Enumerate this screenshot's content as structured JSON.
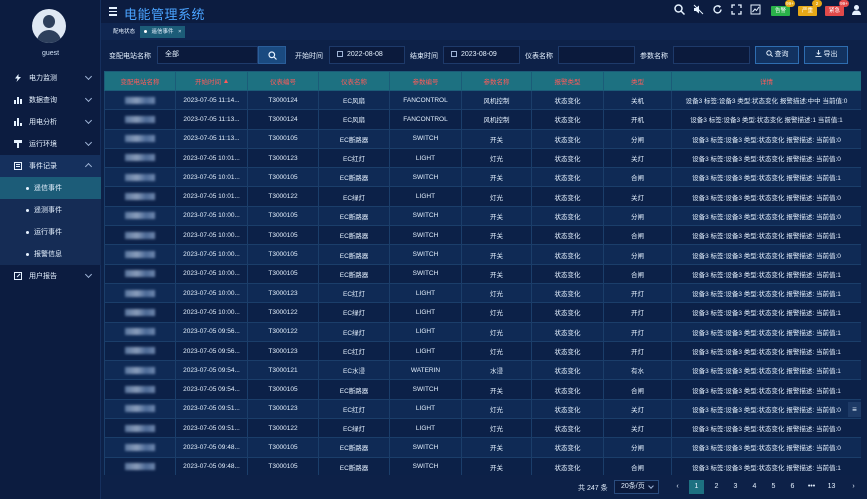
{
  "user": {
    "name": "guest"
  },
  "app": {
    "title": "电能管理系统"
  },
  "menu": {
    "items": [
      {
        "label": "电力监测",
        "icon": "lightning-icon"
      },
      {
        "label": "数据查询",
        "icon": "bar-chart-icon"
      },
      {
        "label": "用电分析",
        "icon": "bar-chart-icon"
      },
      {
        "label": "运行环境",
        "icon": "sensor-icon"
      },
      {
        "label": "事件记录",
        "icon": "document-icon"
      },
      {
        "label": "用户报告",
        "icon": "edit-icon"
      }
    ],
    "sub": [
      "遥信事件",
      "遥测事件",
      "运行事件",
      "报警信息"
    ]
  },
  "header": {
    "badges": [
      {
        "label": "告警",
        "count": "99+",
        "color": "#2ab34a"
      },
      {
        "label": "严重",
        "count": "2",
        "color": "#e6a817"
      },
      {
        "label": "紧急",
        "count": "99+",
        "color": "#e24a4a"
      }
    ]
  },
  "tabs": {
    "t1": "配电状态",
    "t2": "遥信事件",
    "t2_close": "×"
  },
  "filters": {
    "station_label": "变配电站名称",
    "station_value": "全部",
    "start_label": "开始时间",
    "start_value": "2022-08-08",
    "end_label": "结束时间",
    "end_value": "2023-08-09",
    "meter_label": "仪表名称",
    "param_label": "参数名称",
    "query_label": "查询",
    "export_label": "导出"
  },
  "table": {
    "headers": [
      "变配电站名称",
      "开始时间",
      "仪表编号",
      "仪表名称",
      "参数编号",
      "参数名称",
      "报警类型",
      "类型",
      "详情"
    ],
    "rows": [
      [
        "2023-07-05 11:14...",
        "T3000124",
        "EC风扇",
        "FANCONTROL",
        "风机控制",
        "状态变化",
        "关机",
        "设备3 标签:设备3 类型:状态变化 报警描述:中中 当前值:0"
      ],
      [
        "2023-07-05 11:13...",
        "T3000124",
        "EC风扇",
        "FANCONTROL",
        "风机控制",
        "状态变化",
        "开机",
        "设备3 标签:设备3 类型:状态变化 报警描述:1 当前值:1"
      ],
      [
        "2023-07-05 11:13...",
        "T3000105",
        "EC断路器",
        "SWITCH",
        "开关",
        "状态变化",
        "分闸",
        "设备3 标签:设备3 类型:状态变化 报警描述: 当前值:0"
      ],
      [
        "2023-07-05 10:01...",
        "T3000123",
        "EC红灯",
        "LIGHT",
        "灯光",
        "状态变化",
        "关灯",
        "设备3 标签:设备3 类型:状态变化 报警描述: 当前值:0"
      ],
      [
        "2023-07-05 10:01...",
        "T3000105",
        "EC断路器",
        "SWITCH",
        "开关",
        "状态变化",
        "合闸",
        "设备3 标签:设备3 类型:状态变化 报警描述: 当前值:1"
      ],
      [
        "2023-07-05 10:01...",
        "T3000122",
        "EC绿灯",
        "LIGHT",
        "灯光",
        "状态变化",
        "关灯",
        "设备3 标签:设备3 类型:状态变化 报警描述: 当前值:0"
      ],
      [
        "2023-07-05 10:00...",
        "T3000105",
        "EC断路器",
        "SWITCH",
        "开关",
        "状态变化",
        "分闸",
        "设备3 标签:设备3 类型:状态变化 报警描述: 当前值:0"
      ],
      [
        "2023-07-05 10:00...",
        "T3000105",
        "EC断路器",
        "SWITCH",
        "开关",
        "状态变化",
        "合闸",
        "设备3 标签:设备3 类型:状态变化 报警描述: 当前值:1"
      ],
      [
        "2023-07-05 10:00...",
        "T3000105",
        "EC断路器",
        "SWITCH",
        "开关",
        "状态变化",
        "分闸",
        "设备3 标签:设备3 类型:状态变化 报警描述: 当前值:0"
      ],
      [
        "2023-07-05 10:00...",
        "T3000105",
        "EC断路器",
        "SWITCH",
        "开关",
        "状态变化",
        "合闸",
        "设备3 标签:设备3 类型:状态变化 报警描述: 当前值:1"
      ],
      [
        "2023-07-05 10:00...",
        "T3000123",
        "EC红灯",
        "LIGHT",
        "灯光",
        "状态变化",
        "开灯",
        "设备3 标签:设备3 类型:状态变化 报警描述: 当前值:1"
      ],
      [
        "2023-07-05 10:00...",
        "T3000122",
        "EC绿灯",
        "LIGHT",
        "灯光",
        "状态变化",
        "开灯",
        "设备3 标签:设备3 类型:状态变化 报警描述: 当前值:1"
      ],
      [
        "2023-07-05 09:56...",
        "T3000122",
        "EC绿灯",
        "LIGHT",
        "灯光",
        "状态变化",
        "开灯",
        "设备3 标签:设备3 类型:状态变化 报警描述: 当前值:1"
      ],
      [
        "2023-07-05 09:56...",
        "T3000123",
        "EC红灯",
        "LIGHT",
        "灯光",
        "状态变化",
        "开灯",
        "设备3 标签:设备3 类型:状态变化 报警描述: 当前值:1"
      ],
      [
        "2023-07-05 09:54...",
        "T3000121",
        "EC水浸",
        "WATERIN",
        "水浸",
        "状态变化",
        "有水",
        "设备3 标签:设备3 类型:状态变化 报警描述: 当前值:1"
      ],
      [
        "2023-07-05 09:54...",
        "T3000105",
        "EC断路器",
        "SWITCH",
        "开关",
        "状态变化",
        "合闸",
        "设备3 标签:设备3 类型:状态变化 报警描述: 当前值:1"
      ],
      [
        "2023-07-05 09:51...",
        "T3000123",
        "EC红灯",
        "LIGHT",
        "灯光",
        "状态变化",
        "关灯",
        "设备3 标签:设备3 类型:状态变化 报警描述: 当前值:0"
      ],
      [
        "2023-07-05 09:51...",
        "T3000122",
        "EC绿灯",
        "LIGHT",
        "灯光",
        "状态变化",
        "关灯",
        "设备3 标签:设备3 类型:状态变化 报警描述: 当前值:0"
      ],
      [
        "2023-07-05 09:48...",
        "T3000105",
        "EC断路器",
        "SWITCH",
        "开关",
        "状态变化",
        "分闸",
        "设备3 标签:设备3 类型:状态变化 报警描述: 当前值:0"
      ],
      [
        "2023-07-05 09:48...",
        "T3000105",
        "EC断路器",
        "SWITCH",
        "开关",
        "状态变化",
        "合闸",
        "设备3 标签:设备3 类型:状态变化 报警描述: 当前值:1"
      ]
    ]
  },
  "pager": {
    "total": "共 247 条",
    "page_size": "20条/页",
    "prev": "‹",
    "next": "›",
    "pages": [
      "1",
      "2",
      "3",
      "4",
      "5",
      "6",
      "•••",
      "13"
    ]
  }
}
